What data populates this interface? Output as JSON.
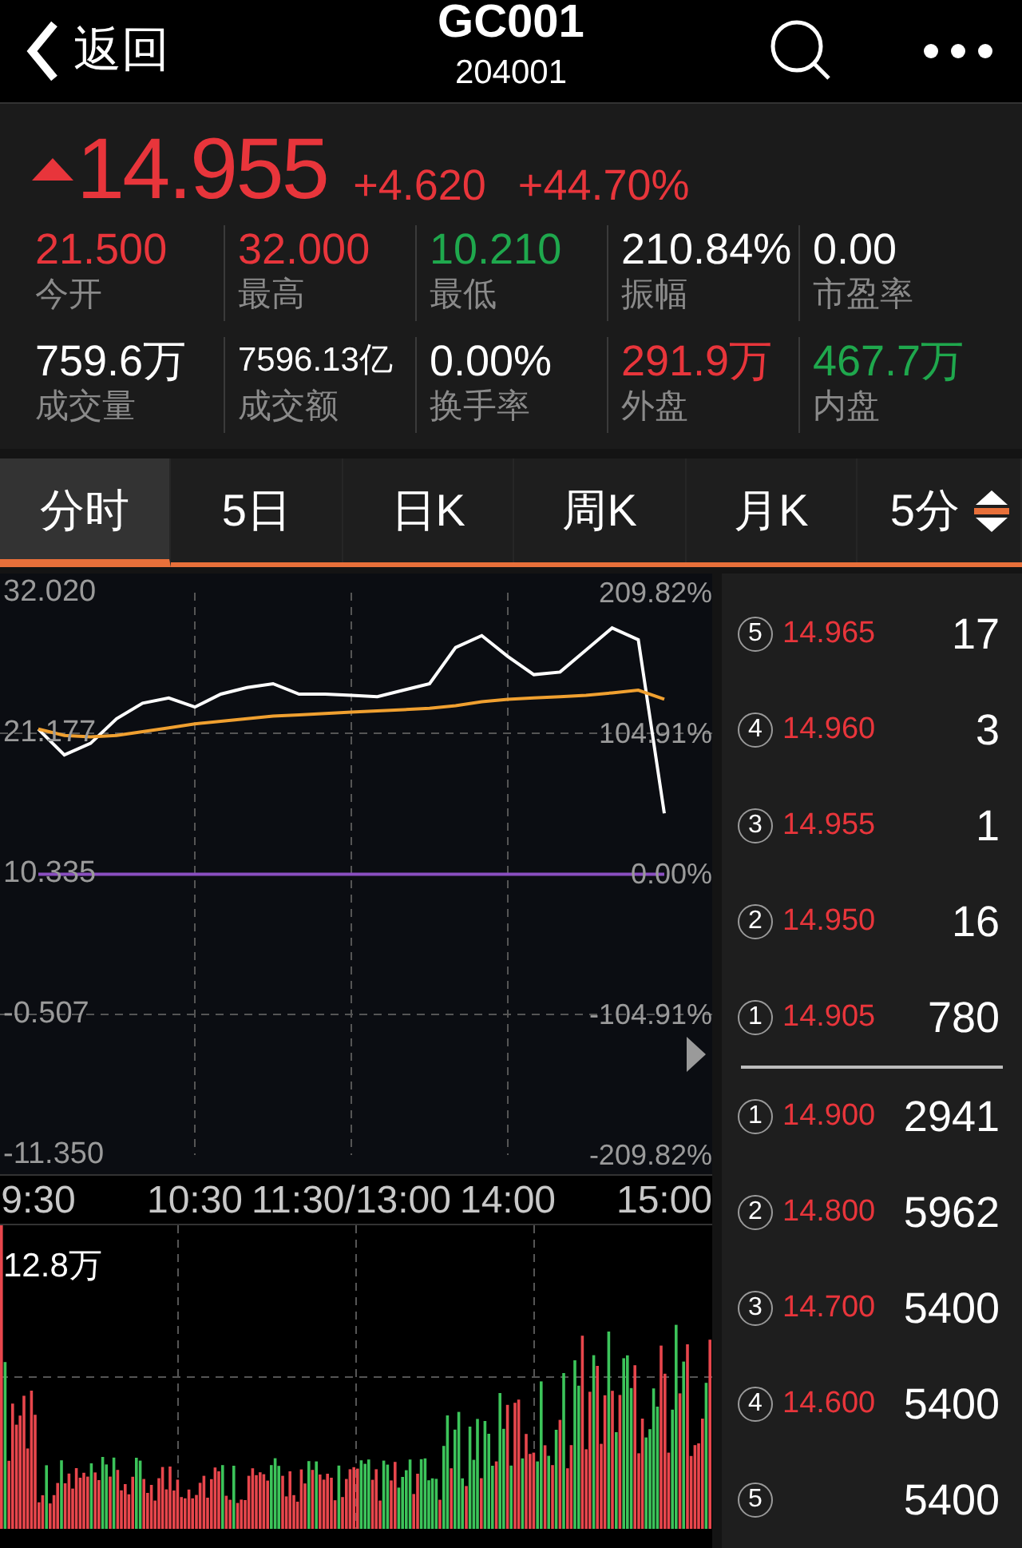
{
  "header": {
    "back_label": "返回",
    "title": "GC001",
    "code": "204001"
  },
  "quote": {
    "price": "14.955",
    "change": "+4.620",
    "change_pct": "+44.70%",
    "color": "#e8353b",
    "stats": [
      {
        "value": "21.500",
        "label": "今开",
        "color": "#e8353b"
      },
      {
        "value": "32.000",
        "label": "最高",
        "color": "#e8353b"
      },
      {
        "value": "10.210",
        "label": "最低",
        "color": "#1fa84d"
      },
      {
        "value": "210.84%",
        "label": "振幅",
        "color": "#ffffff"
      },
      {
        "value": "0.00",
        "label": "市盈率",
        "color": "#ffffff"
      },
      {
        "value": "759.6万",
        "label": "成交量",
        "color": "#ffffff"
      },
      {
        "value": "7596.13亿",
        "label": "成交额",
        "color": "#ffffff"
      },
      {
        "value": "0.00%",
        "label": "换手率",
        "color": "#ffffff"
      },
      {
        "value": "291.9万",
        "label": "外盘",
        "color": "#e8353b"
      },
      {
        "value": "467.7万",
        "label": "内盘",
        "color": "#1fa84d"
      }
    ]
  },
  "tabs": [
    {
      "label": "分时",
      "selected": true
    },
    {
      "label": "5日",
      "selected": false
    },
    {
      "label": "日K",
      "selected": false
    },
    {
      "label": "周K",
      "selected": false
    },
    {
      "label": "月K",
      "selected": false
    },
    {
      "label": "5分",
      "selected": false,
      "kind": "dropdown"
    }
  ],
  "price_chart": {
    "right_labels": [
      "209.82%",
      "104.91%",
      "0.00%",
      "-104.91%",
      "-209.82%"
    ],
    "chart_data": {
      "type": "line",
      "grid": true,
      "categories": [
        "9:30",
        null,
        null,
        null,
        null,
        null,
        "10:30",
        null,
        null,
        null,
        null,
        null,
        "11:30/13:00",
        null,
        null,
        null,
        null,
        null,
        "14:00",
        null,
        null,
        null,
        null,
        null,
        "15:00"
      ],
      "ylim": [
        -11.35,
        32.02
      ],
      "yticks": [
        {
          "value": 32.02,
          "label": "32.020"
        },
        {
          "value": 21.177,
          "label": "21.177"
        },
        {
          "value": 10.335,
          "label": "10.335"
        },
        {
          "value": -0.507,
          "label": "-0.507"
        },
        {
          "value": -11.35,
          "label": "-11.350"
        }
      ],
      "series": [
        {
          "color": "#ffffff",
          "values": [
            21.5,
            19.5,
            20.4,
            22.3,
            23.5,
            23.9,
            23.2,
            24.2,
            24.7,
            25.0,
            24.2,
            24.2,
            24.1,
            24.0,
            24.5,
            25.0,
            27.8,
            28.7,
            27.1,
            25.7,
            25.9,
            27.6,
            29.3,
            28.4,
            15.0
          ]
        },
        {
          "color": "#f0a030",
          "values": [
            21.5,
            21.0,
            20.9,
            21.0,
            21.3,
            21.6,
            21.9,
            22.1,
            22.3,
            22.5,
            22.6,
            22.7,
            22.8,
            22.9,
            23.0,
            23.1,
            23.3,
            23.6,
            23.8,
            23.9,
            24.0,
            24.1,
            24.3,
            24.5,
            23.8
          ]
        },
        {
          "color": "#8a4fc0",
          "values": [
            10.3,
            10.3,
            10.3,
            10.3,
            10.3,
            10.3,
            10.3,
            10.3,
            10.3,
            10.3,
            10.3,
            10.3,
            10.3,
            10.3,
            10.3,
            10.3,
            10.3,
            10.3,
            10.3,
            10.3,
            10.3,
            10.3,
            10.3,
            10.3,
            10.3
          ]
        }
      ]
    }
  },
  "volume_chart": {
    "max_label": "12.8万"
  },
  "order_book": {
    "asks": [
      {
        "level": "5",
        "price": "14.965",
        "volume": "17"
      },
      {
        "level": "4",
        "price": "14.960",
        "volume": "3"
      },
      {
        "level": "3",
        "price": "14.955",
        "volume": "1"
      },
      {
        "level": "2",
        "price": "14.950",
        "volume": "16"
      },
      {
        "level": "1",
        "price": "14.905",
        "volume": "780"
      }
    ],
    "bids": [
      {
        "level": "1",
        "price": "14.900",
        "volume": "2941"
      },
      {
        "level": "2",
        "price": "14.800",
        "volume": "5962"
      },
      {
        "level": "3",
        "price": "14.700",
        "volume": "5400"
      },
      {
        "level": "4",
        "price": "14.600",
        "volume": "5400"
      },
      {
        "level": "5",
        "volume": "5400"
      }
    ]
  }
}
